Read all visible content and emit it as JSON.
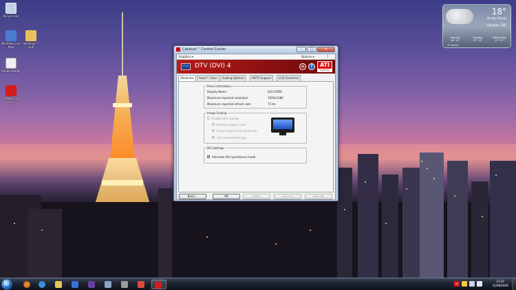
{
  "desktop": {
    "icons": [
      {
        "label": "Recycle Bin",
        "icon": "recycle-bin-icon",
        "color": "#bfd2e6"
      },
      {
        "label": "Windows Live Mail",
        "icon": "windows-live-mail-icon",
        "color": "#4a7bd0"
      },
      {
        "label": "Windows 7 stuff",
        "icon": "folder-icon",
        "color": "#e8c35a"
      },
      {
        "label": "Adobe Reader",
        "icon": "document-icon",
        "color": "#f0f0f0"
      },
      {
        "label": "Catalyst Ctrl Cen...",
        "icon": "ati-icon",
        "color": "#d21c1c"
      }
    ]
  },
  "weather": {
    "temp": "18°",
    "condition": "Mostly Cloudy",
    "location": "Glasgow, GBR",
    "days": [
      {
        "name": "Monday",
        "hi": "18°",
        "lo": "11°"
      },
      {
        "name": "Tuesday",
        "hi": "17°",
        "lo": "10°"
      },
      {
        "name": "Wednesday",
        "hi": "17°",
        "lo": "13°"
      }
    ],
    "source": "© Foreca"
  },
  "window": {
    "title": "Catalyst™ Control Center",
    "menus": {
      "graphics": "Graphics ▾",
      "options": "Options ▾"
    },
    "heading": "DTV (DVI) 4",
    "tabs": [
      "Attributes",
      "Avivo™ Color",
      "Scaling Options",
      "HDTV Support",
      "LCD Overdrive"
    ],
    "panel_info": {
      "title": "Panel information",
      "rows": [
        {
          "label": "Display Name:",
          "value": "42LG7000"
        },
        {
          "label": "Maximum reported resolution:",
          "value": "1920x1080"
        },
        {
          "label": "Maximum reported refresh rate:",
          "value": "75 Hz"
        }
      ]
    },
    "image_scaling": {
      "title": "Image Scaling",
      "enable": "Enable GPU scaling",
      "options": [
        "Maintain aspect ratio",
        "Scale image to full panel size",
        "Use centered timings"
      ]
    },
    "dvi_settings": {
      "title": "DVI Settings",
      "checkbox": "Alternate DVI operational mode"
    },
    "buttons": {
      "basic": "Basic...",
      "ok": "OK",
      "apply": "Apply",
      "discard": "Discard",
      "defaults": "Defaults"
    },
    "ati_logo": {
      "brand": "ATI",
      "sub": "RADEON GRAPHICS"
    }
  },
  "taskbar": {
    "clock_time": "13:32",
    "clock_date": "31/08/2009",
    "tray_label": "ATI",
    "colors": {
      "accent": "#d21c1c"
    }
  }
}
